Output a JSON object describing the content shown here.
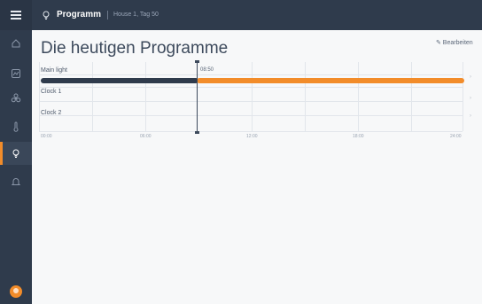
{
  "topbar": {
    "title": "Programm",
    "subtitle": "House 1, Tag 50"
  },
  "page": {
    "title": "Die heutigen Programme",
    "edit_label": "✎ Bearbeiten"
  },
  "sidebar": {
    "items": [
      {
        "icon": "home-icon",
        "active": false
      },
      {
        "icon": "dashboard-icon",
        "active": false
      },
      {
        "icon": "fan-icon",
        "active": false
      },
      {
        "icon": "thermometer-icon",
        "active": false
      },
      {
        "icon": "lightbulb-icon",
        "active": true
      },
      {
        "icon": "bell-icon",
        "active": false
      }
    ]
  },
  "timeline": {
    "rows": [
      {
        "label": "Main light"
      },
      {
        "label": "Clock 1"
      },
      {
        "label": "Clock 2"
      }
    ],
    "now_label": "08:50",
    "ticks": [
      "00:00",
      "06:00",
      "12:00",
      "18:00",
      "24:00"
    ],
    "main_light": {
      "done_color": "#2f3b4c",
      "todo_color": "#f28c2a"
    }
  }
}
